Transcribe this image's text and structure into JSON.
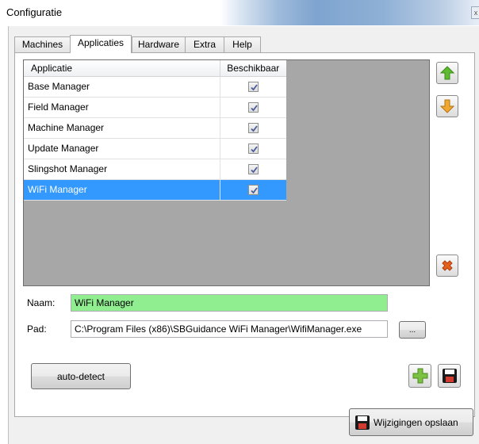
{
  "window": {
    "title": "Configuratie",
    "close_glyph": "x"
  },
  "tabs": [
    {
      "label": "Machines"
    },
    {
      "label": "Applicaties"
    },
    {
      "label": "Hardware"
    },
    {
      "label": "Extra"
    },
    {
      "label": "Help"
    }
  ],
  "active_tab": "Applicaties",
  "grid": {
    "columns": [
      "Applicatie",
      "Beschikbaar"
    ],
    "rows": [
      {
        "name": "Base Manager",
        "available": true
      },
      {
        "name": "Field Manager",
        "available": true
      },
      {
        "name": "Machine Manager",
        "available": true
      },
      {
        "name": "Update Manager",
        "available": true
      },
      {
        "name": "Slingshot Manager",
        "available": true
      },
      {
        "name": "WiFi Manager",
        "available": true
      }
    ],
    "selected_row": "WiFi Manager",
    "selection_color": "#3399ff"
  },
  "form": {
    "naam_label": "Naam:",
    "naam_value": "WiFi Manager",
    "pad_label": "Pad:",
    "pad_value": "C:\\Program Files (x86)\\SBGuidance WiFi Manager\\WifiManager.exe",
    "browse_label": "...",
    "highlight_color": "#90ee90"
  },
  "buttons": {
    "auto_detect": "auto-detect",
    "save_changes": "Wijzigingen opslaan"
  },
  "icons": {
    "move_up": "arrow-up-icon",
    "move_down": "arrow-down-icon",
    "delete": "delete-x-icon",
    "add": "plus-icon",
    "save": "floppy-disk-icon"
  }
}
